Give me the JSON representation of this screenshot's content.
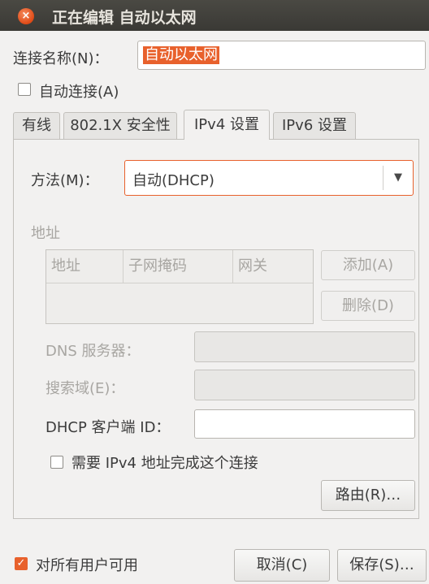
{
  "window": {
    "title": "正在编辑 自动以太网",
    "close_glyph": "×"
  },
  "connection_name": {
    "label": "连接名称(N)：",
    "value": "自动以太网"
  },
  "auto_connect": {
    "label": "自动连接(A)",
    "checked": false
  },
  "tabs": [
    {
      "label": "有线",
      "active": false
    },
    {
      "label": "802.1X 安全性",
      "active": false
    },
    {
      "label": "IPv4 设置",
      "active": true
    },
    {
      "label": "IPv6 设置",
      "active": false
    }
  ],
  "ipv4": {
    "method_label": "方法(M)：",
    "method_value": "自动(DHCP)",
    "dropdown_arrow": "▼",
    "address_section": "地址",
    "columns": [
      "地址",
      "子网掩码",
      "网关"
    ],
    "add_button": "添加(A)",
    "delete_button": "删除(D)",
    "dns_label": "DNS 服务器：",
    "search_label": "搜索域(E)：",
    "dhcp_label": "DHCP 客户端 ID：",
    "dhcp_value": "",
    "require_label": "需要 IPv4 地址完成这个连接",
    "require_checked": false,
    "routes_button": "路由(R)…"
  },
  "footer": {
    "all_users_label": "对所有用户可用",
    "all_users_checked": true,
    "cancel_button": "取消(C)",
    "save_button": "保存(S)…"
  },
  "colors": {
    "accent": "#e8612c",
    "titlebar": "#3f3e39",
    "highlight": "#e8612c"
  }
}
